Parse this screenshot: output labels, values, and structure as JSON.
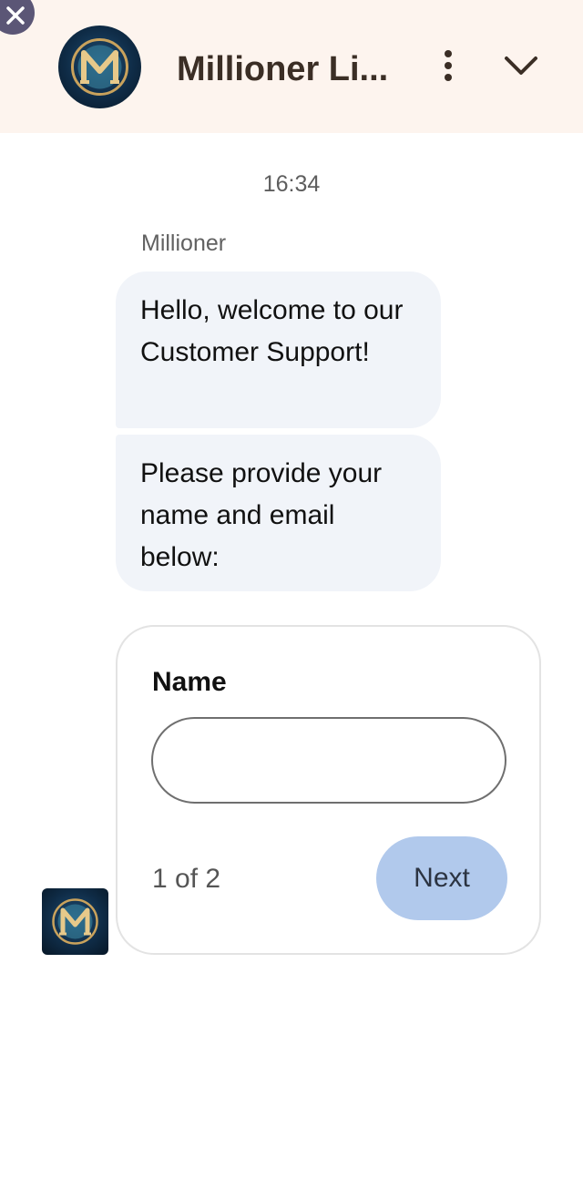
{
  "header": {
    "title": "Millioner Li...",
    "logo": "millioner-m-logo",
    "menu_icon": "vertical-ellipsis-icon",
    "collapse_icon": "chevron-down-icon",
    "close_icon": "close-icon",
    "background": "#fdf4ee"
  },
  "chat": {
    "timestamp": "16:34",
    "sender": "Millioner",
    "messages": [
      "Hello, welcome to our Customer Support!",
      "Please provide your name and email below:"
    ],
    "bubble_color": "#f1f4f9"
  },
  "form": {
    "field_label": "Name",
    "field_value": "",
    "pager": "1 of 2",
    "next_label": "Next",
    "next_color": "#b1c9ec"
  }
}
